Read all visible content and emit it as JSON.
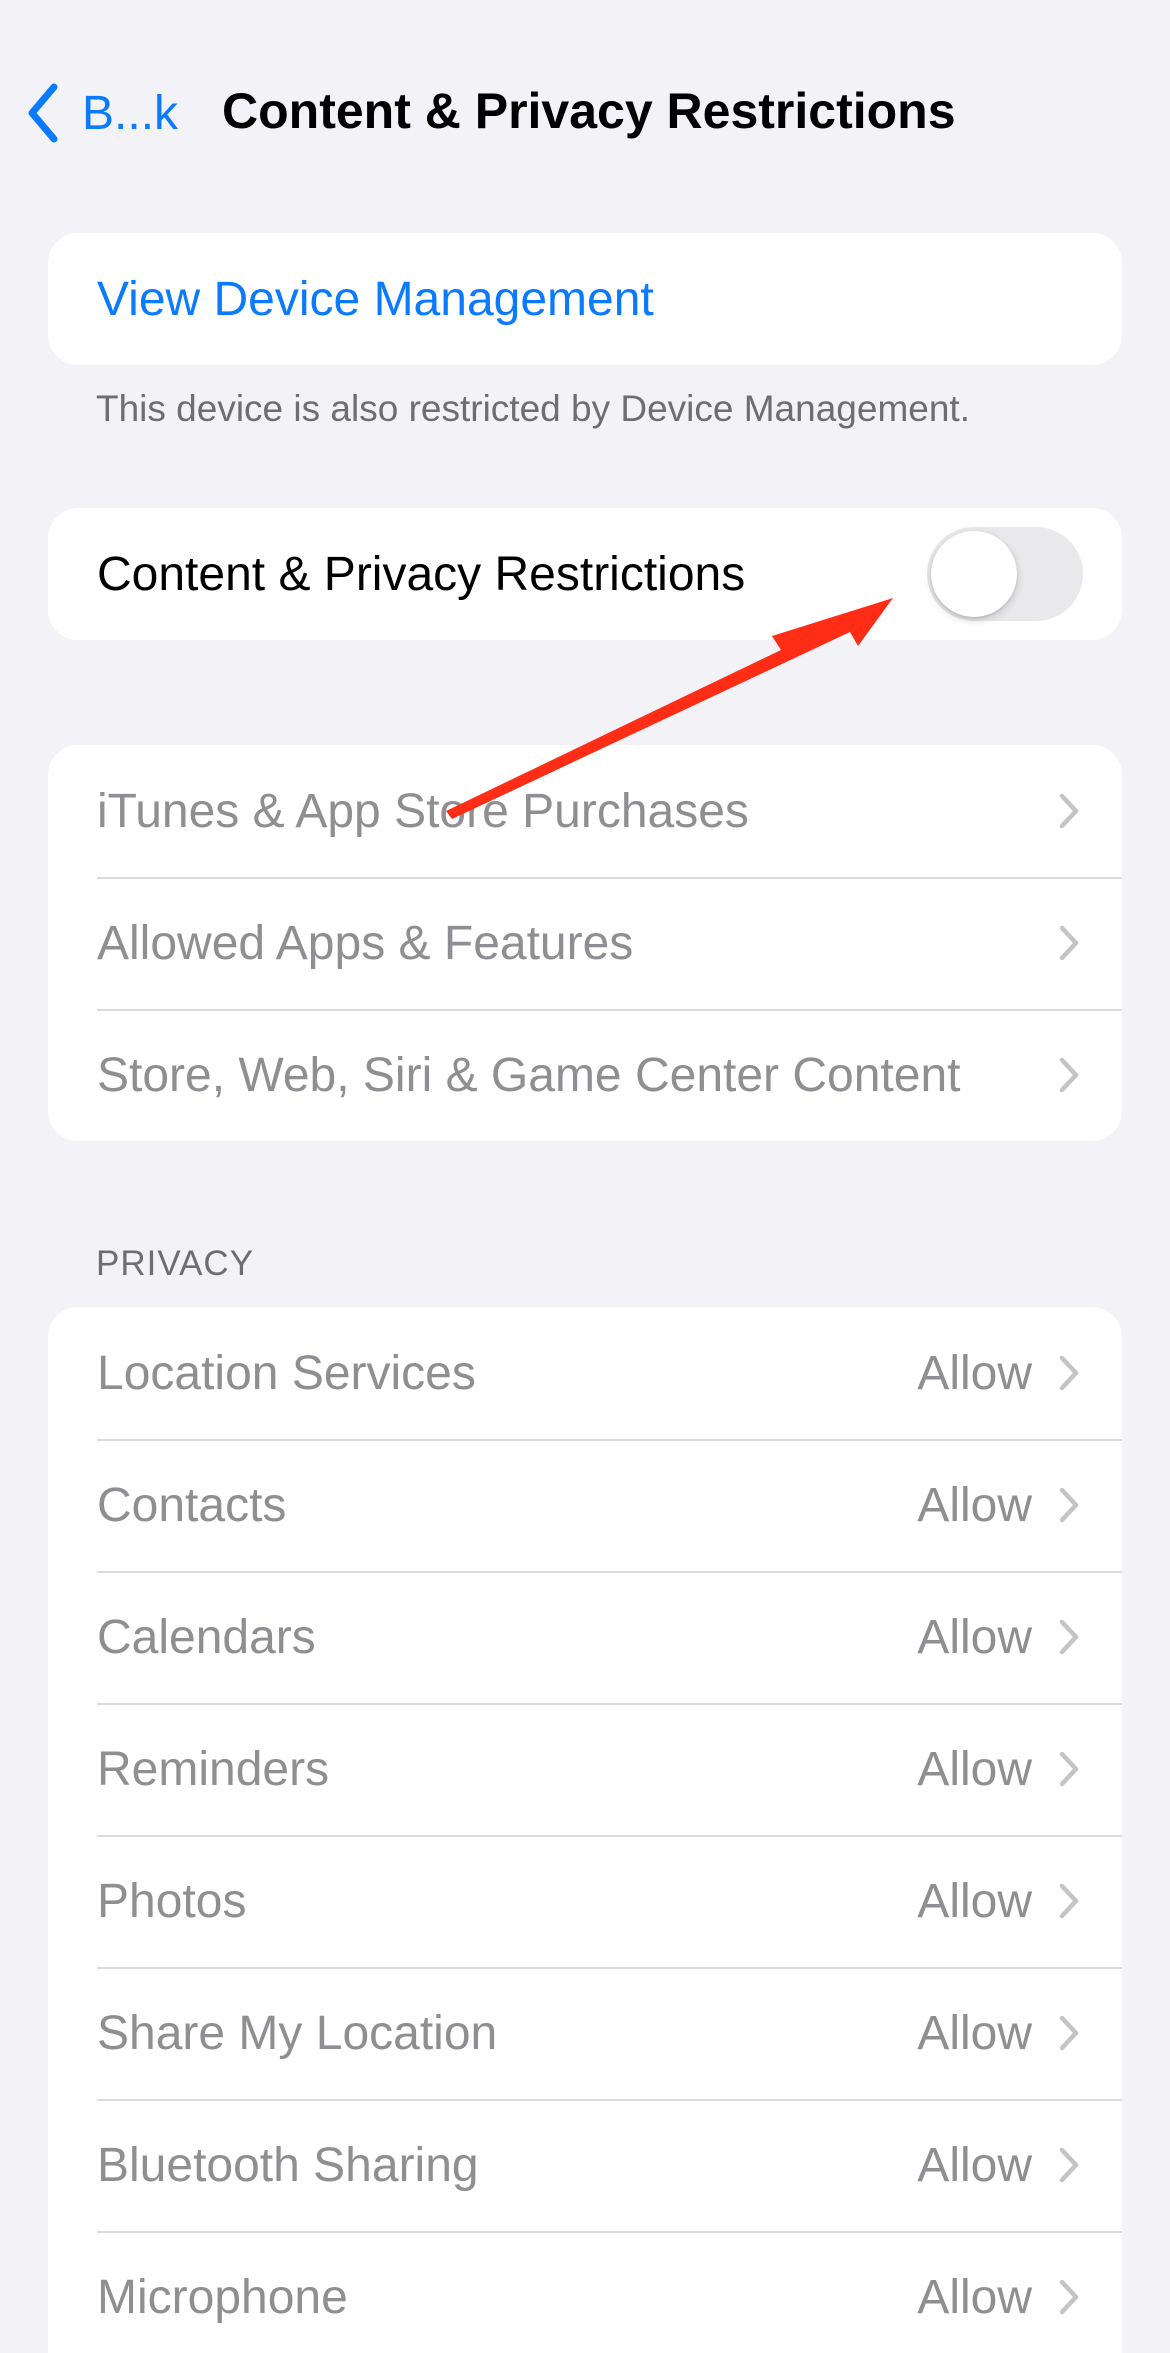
{
  "nav": {
    "back_label": "B...k",
    "title": "Content & Privacy Restrictions"
  },
  "device_management": {
    "link_label": "View Device Management",
    "footnote": "This device is also restricted by Device Management."
  },
  "master_toggle": {
    "label": "Content & Privacy Restrictions",
    "state": "off"
  },
  "store_group": {
    "items": [
      {
        "label": "iTunes & App Store Purchases"
      },
      {
        "label": "Allowed Apps & Features"
      },
      {
        "label": "Store, Web, Siri & Game Center Content"
      }
    ]
  },
  "privacy": {
    "header": "PRIVACY",
    "items": [
      {
        "label": "Location Services",
        "value": "Allow"
      },
      {
        "label": "Contacts",
        "value": "Allow"
      },
      {
        "label": "Calendars",
        "value": "Allow"
      },
      {
        "label": "Reminders",
        "value": "Allow"
      },
      {
        "label": "Photos",
        "value": "Allow"
      },
      {
        "label": "Share My Location",
        "value": "Allow"
      },
      {
        "label": "Bluetooth Sharing",
        "value": "Allow"
      },
      {
        "label": "Microphone",
        "value": "Allow"
      }
    ]
  },
  "colors": {
    "accent": "#0a7aff",
    "background": "#f2f2f7",
    "disabled_text": "#8e8e93",
    "annotation_arrow": "#ff2d16"
  }
}
